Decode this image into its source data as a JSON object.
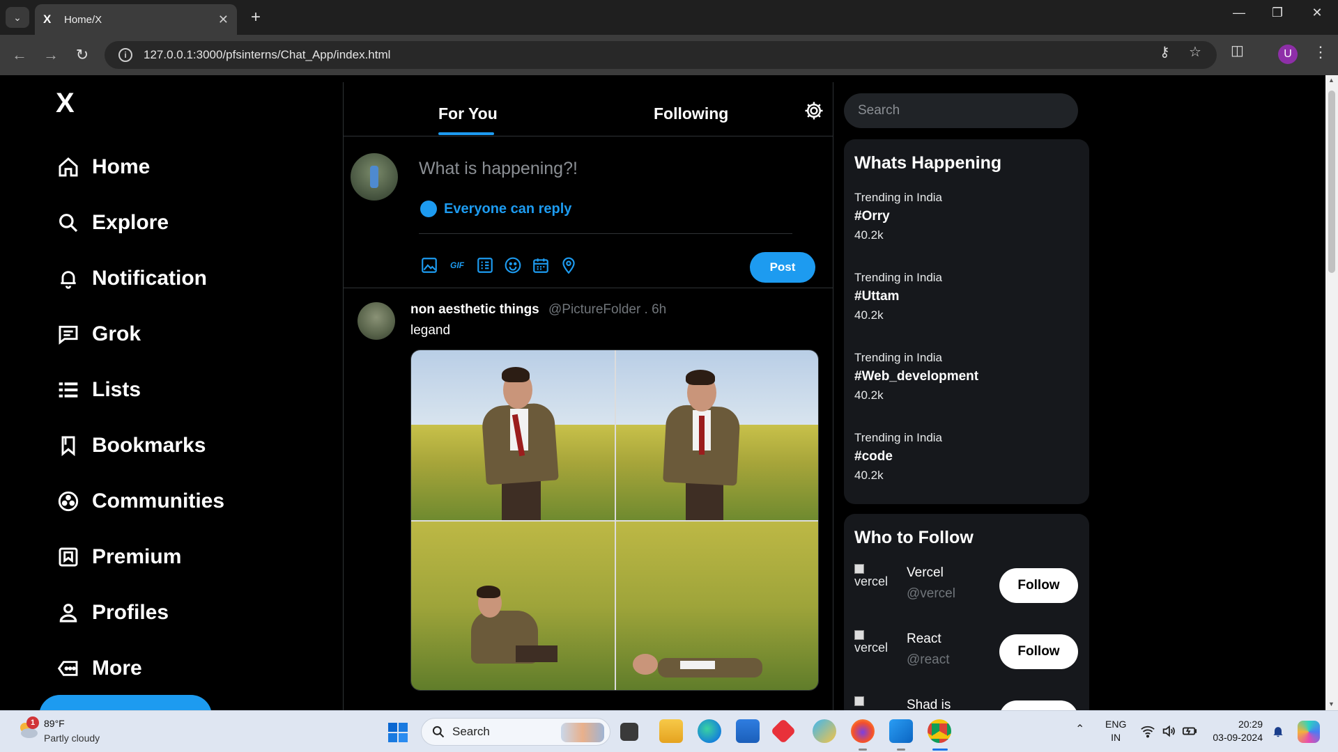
{
  "browser": {
    "tab_title": "Home/X",
    "tab_favicon": "X",
    "url": "127.0.0.1:3000/pfsinterns/Chat_App/index.html",
    "profile_initial": "U"
  },
  "sidebar": {
    "logo": "X",
    "items": [
      {
        "label": "Home",
        "icon": "home-icon"
      },
      {
        "label": "Explore",
        "icon": "search-icon"
      },
      {
        "label": "Notification",
        "icon": "bell-icon"
      },
      {
        "label": "Grok",
        "icon": "message-icon"
      },
      {
        "label": "Lists",
        "icon": "list-icon"
      },
      {
        "label": "Bookmarks",
        "icon": "bookmark-icon"
      },
      {
        "label": "Communities",
        "icon": "communities-icon"
      },
      {
        "label": "Premium",
        "icon": "premium-icon"
      },
      {
        "label": "Profiles",
        "icon": "person-icon"
      },
      {
        "label": "More",
        "icon": "more-icon"
      }
    ]
  },
  "feed": {
    "tabs": [
      "For You",
      "Following"
    ],
    "active_tab": "For You",
    "composer": {
      "placeholder": "What is happening?!",
      "reply_setting": "Everyone can reply",
      "post_label": "Post",
      "tools": [
        "image-icon",
        "gif-icon",
        "poll-icon",
        "emoji-icon",
        "schedule-icon",
        "location-icon"
      ],
      "gif_label": "GIF"
    },
    "tweet": {
      "name": "non aesthetic things",
      "handle": "@PictureFolder . 6h",
      "text": "legand"
    }
  },
  "right": {
    "search_placeholder": "Search",
    "trends_title": "Whats Happening",
    "trends": [
      {
        "category": "Trending in India",
        "tag": "#Orry",
        "count": "40.2k"
      },
      {
        "category": "Trending in India",
        "tag": "#Uttam",
        "count": "40.2k"
      },
      {
        "category": "Trending in India",
        "tag": "#Web_development",
        "count": "40.2k"
      },
      {
        "category": "Trending in India",
        "tag": "#code",
        "count": "40.2k"
      }
    ],
    "follow_title": "Who to Follow",
    "follow": [
      {
        "alt": "vercel",
        "name": "Vercel",
        "handle": "@vercel",
        "button": "Follow"
      },
      {
        "alt": "vercel",
        "name": "React",
        "handle": "@react",
        "button": "Follow"
      },
      {
        "alt": "",
        "name": "Shad is",
        "handle": "",
        "button": ""
      }
    ]
  },
  "taskbar": {
    "weather_temp": "89°F",
    "weather_cond": "Partly cloudy",
    "weather_badge": "1",
    "search_label": "Search",
    "lang_1": "ENG",
    "lang_2": "IN",
    "time": "20:29",
    "date": "03-09-2024"
  },
  "colors": {
    "accent": "#1d9bf0",
    "background": "#000000",
    "panel": "#16181c"
  }
}
